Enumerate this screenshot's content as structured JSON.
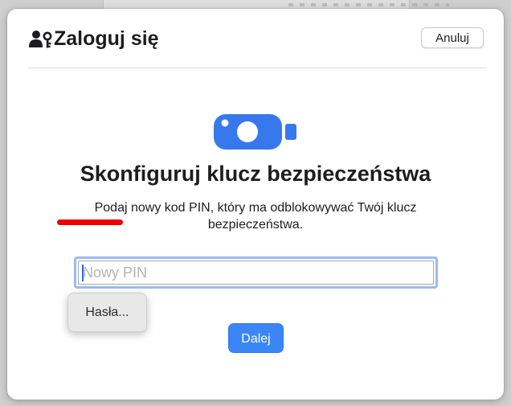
{
  "dialog": {
    "title": "Zaloguj się",
    "cancel_label": "Anuluj",
    "heading": "Skonfiguruj klucz bezpieczeństwa",
    "description": "Podaj nowy kod PIN, który ma odblokowywać Twój klucz bezpieczeństwa.",
    "pin_placeholder": "Nowy PIN",
    "pin_value": "",
    "passwords_label": "Hasła...",
    "next_label": "Dalej"
  },
  "icons": {
    "title_icon": "user-key-icon",
    "key_icon": "security-key-icon"
  },
  "colors": {
    "accent": "#3b86f6",
    "key_icon": "#3779ec",
    "focus_ring": "#9db9f0",
    "annotation": "#ee0000"
  }
}
